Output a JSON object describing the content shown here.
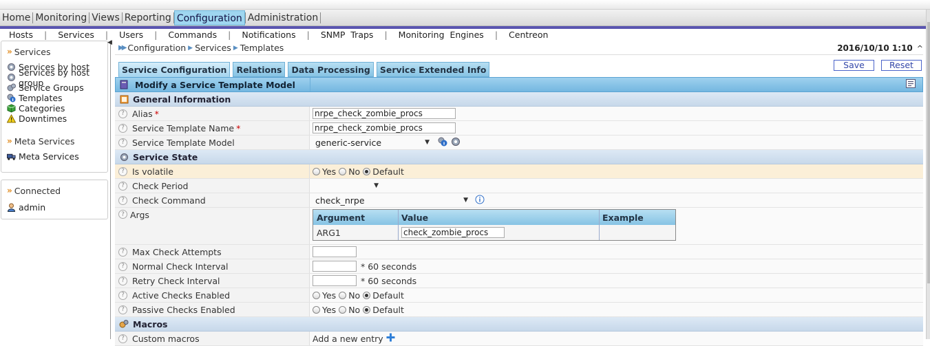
{
  "topmenu": [
    "Home",
    "Monitoring",
    "Views",
    "Reporting",
    "Configuration",
    "Administration"
  ],
  "topmenu_active": "Configuration",
  "submenu": [
    "Hosts",
    "Services",
    "Users",
    "Commands",
    "Notifications",
    "SNMP  Traps",
    "Monitoring  Engines",
    "Centreon"
  ],
  "sidebar": {
    "services_title": "Services",
    "services_items": [
      "Services by host",
      "Services by host group",
      "Service Groups",
      "Templates",
      "Categories",
      "Downtimes"
    ],
    "meta_title": "Meta Services",
    "meta_item": "Meta Services",
    "connected_title": "Connected",
    "user": "admin"
  },
  "breadcrumb": [
    "Configuration",
    "Services",
    "Templates"
  ],
  "datetime": "2016/10/10 1:10",
  "tabs": [
    "Service Configuration",
    "Relations",
    "Data Processing",
    "Service Extended Info"
  ],
  "buttons": {
    "save": "Save",
    "reset": "Reset"
  },
  "form": {
    "title": "Modify a Service Template Model",
    "general": "General Information",
    "alias_label": "Alias",
    "alias_value": "nrpe_check_zombie_procs",
    "name_label": "Service Template Name",
    "name_value": "nrpe_check_zombie_procs",
    "model_label": "Service Template Model",
    "model_value": "generic-service",
    "state": "Service State",
    "volatile_label": "Is volatile",
    "check_period_label": "Check Period",
    "check_period_value": "",
    "check_command_label": "Check Command",
    "check_command_value": "check_nrpe",
    "args_label": "Args",
    "args_headers": [
      "Argument",
      "Value",
      "Example"
    ],
    "args_row": {
      "argument": "ARG1",
      "value": "check_zombie_procs",
      "example": ""
    },
    "max_attempts_label": "Max Check Attempts",
    "max_attempts_value": "",
    "normal_interval_label": "Normal Check Interval",
    "normal_interval_value": "",
    "retry_interval_label": "Retry Check Interval",
    "retry_interval_value": "",
    "seconds_suffix": "* 60 seconds",
    "active_label": "Active Checks Enabled",
    "passive_label": "Passive Checks Enabled",
    "radio": {
      "yes": "Yes",
      "no": "No",
      "default": "Default"
    },
    "macros": "Macros",
    "custom_macros_label": "Custom macros",
    "add_entry": "Add a new entry"
  }
}
